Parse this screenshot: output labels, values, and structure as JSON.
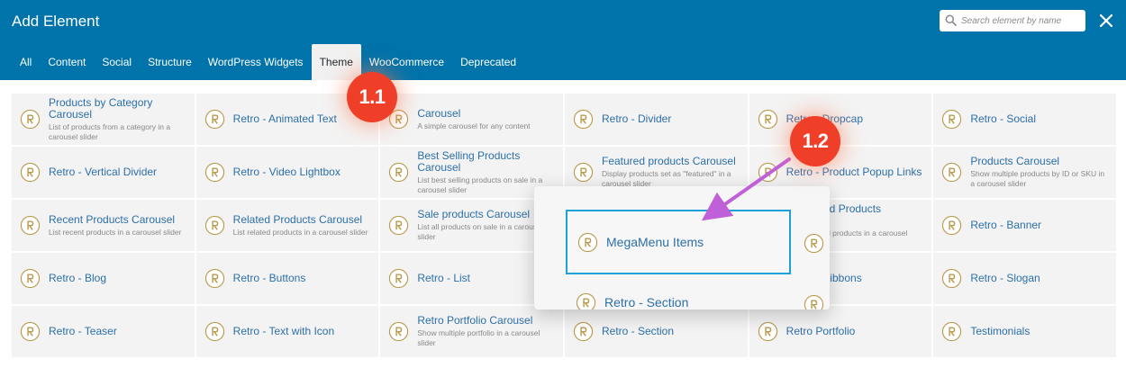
{
  "header": {
    "title": "Add Element",
    "search_placeholder": "Search element by name"
  },
  "tabs": [
    "All",
    "Content",
    "Social",
    "Structure",
    "WordPress Widgets",
    "Theme",
    "WooCommerce",
    "Deprecated"
  ],
  "active_tab": "Theme",
  "colors": {
    "header_bg": "#0073aa",
    "element_name": "#2c6fa9",
    "badge": "#ef3f28",
    "highlight_border": "#1da1d8",
    "arrow": "#c060d8",
    "icon": "#b99a4c"
  },
  "elements": [
    {
      "name": "Products by Category Carousel",
      "desc": "List of products from a category in a carousel slider"
    },
    {
      "name": "Retro - Animated Text",
      "desc": ""
    },
    {
      "name": "Carousel",
      "desc": "A simple carousel for any content"
    },
    {
      "name": "Retro - Divider",
      "desc": ""
    },
    {
      "name": "Retro - Dropcap",
      "desc": ""
    },
    {
      "name": "Retro - Social",
      "desc": ""
    },
    {
      "name": "Retro - Vertical Divider",
      "desc": ""
    },
    {
      "name": "Retro - Video Lightbox",
      "desc": ""
    },
    {
      "name": "Best Selling Products Carousel",
      "desc": "List best selling products on sale in a carousel slider"
    },
    {
      "name": "Featured products Carousel",
      "desc": "Display products set as \"featured\" in a carousel slider"
    },
    {
      "name": "Retro - Product Popup Links",
      "desc": ""
    },
    {
      "name": "Products Carousel",
      "desc": "Show multiple products by ID or SKU in a carousel slider"
    },
    {
      "name": "Recent Products Carousel",
      "desc": "List recent products in a carousel slider"
    },
    {
      "name": "Related Products Carousel",
      "desc": "List related products in a carousel slider"
    },
    {
      "name": "Sale products Carousel",
      "desc": "List all products on sale in a carousel slider"
    },
    {
      "name": "MegaMenu Items",
      "desc": ""
    },
    {
      "name": "Top Rated Products Carousel",
      "desc": "List top rated products in a carousel slider"
    },
    {
      "name": "Retro - Banner",
      "desc": ""
    },
    {
      "name": "Retro - Blog",
      "desc": ""
    },
    {
      "name": "Retro - Buttons",
      "desc": ""
    },
    {
      "name": "Retro - List",
      "desc": ""
    },
    {
      "name": "Retro - Section",
      "desc": ""
    },
    {
      "name": "Retro - Ribbons",
      "desc": ""
    },
    {
      "name": "Retro - Slogan",
      "desc": ""
    },
    {
      "name": "Retro - Teaser",
      "desc": ""
    },
    {
      "name": "Retro - Text with Icon",
      "desc": ""
    },
    {
      "name": "Retro Portfolio Carousel",
      "desc": "Show multiple portfolio in a carousel slider"
    },
    {
      "name": "Retro - Section",
      "desc": ""
    },
    {
      "name": "Retro Portfolio",
      "desc": ""
    },
    {
      "name": "Testimonials",
      "desc": ""
    }
  ],
  "popup": {
    "highlighted": "MegaMenu Items",
    "next": "Retro - Section"
  },
  "annotations": {
    "step1": "1.1",
    "step2": "1.2"
  }
}
